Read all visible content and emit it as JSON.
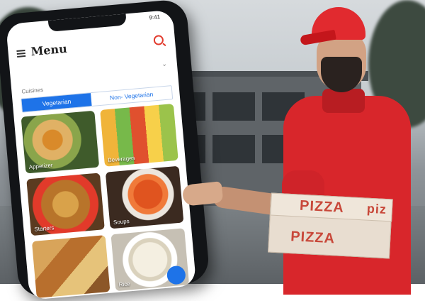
{
  "phone": {
    "status_time": "9:41",
    "title": "Menu",
    "cuisines_label": "Cuisines",
    "toggle": {
      "selected": "Vegetarian",
      "options": [
        "Vegetarian",
        "Non- Vegetarian"
      ]
    },
    "categories": [
      "Appetizer",
      "Beverages",
      "Starters",
      "Soups",
      "",
      "Rice"
    ]
  },
  "box": {
    "print_front": "PIZZA",
    "print_side": "piz",
    "print_bottom": "PIZZA"
  },
  "colors": {
    "accent_blue": "#1e73e8",
    "uniform_red": "#d8262b",
    "search_red": "#e23b2e"
  }
}
